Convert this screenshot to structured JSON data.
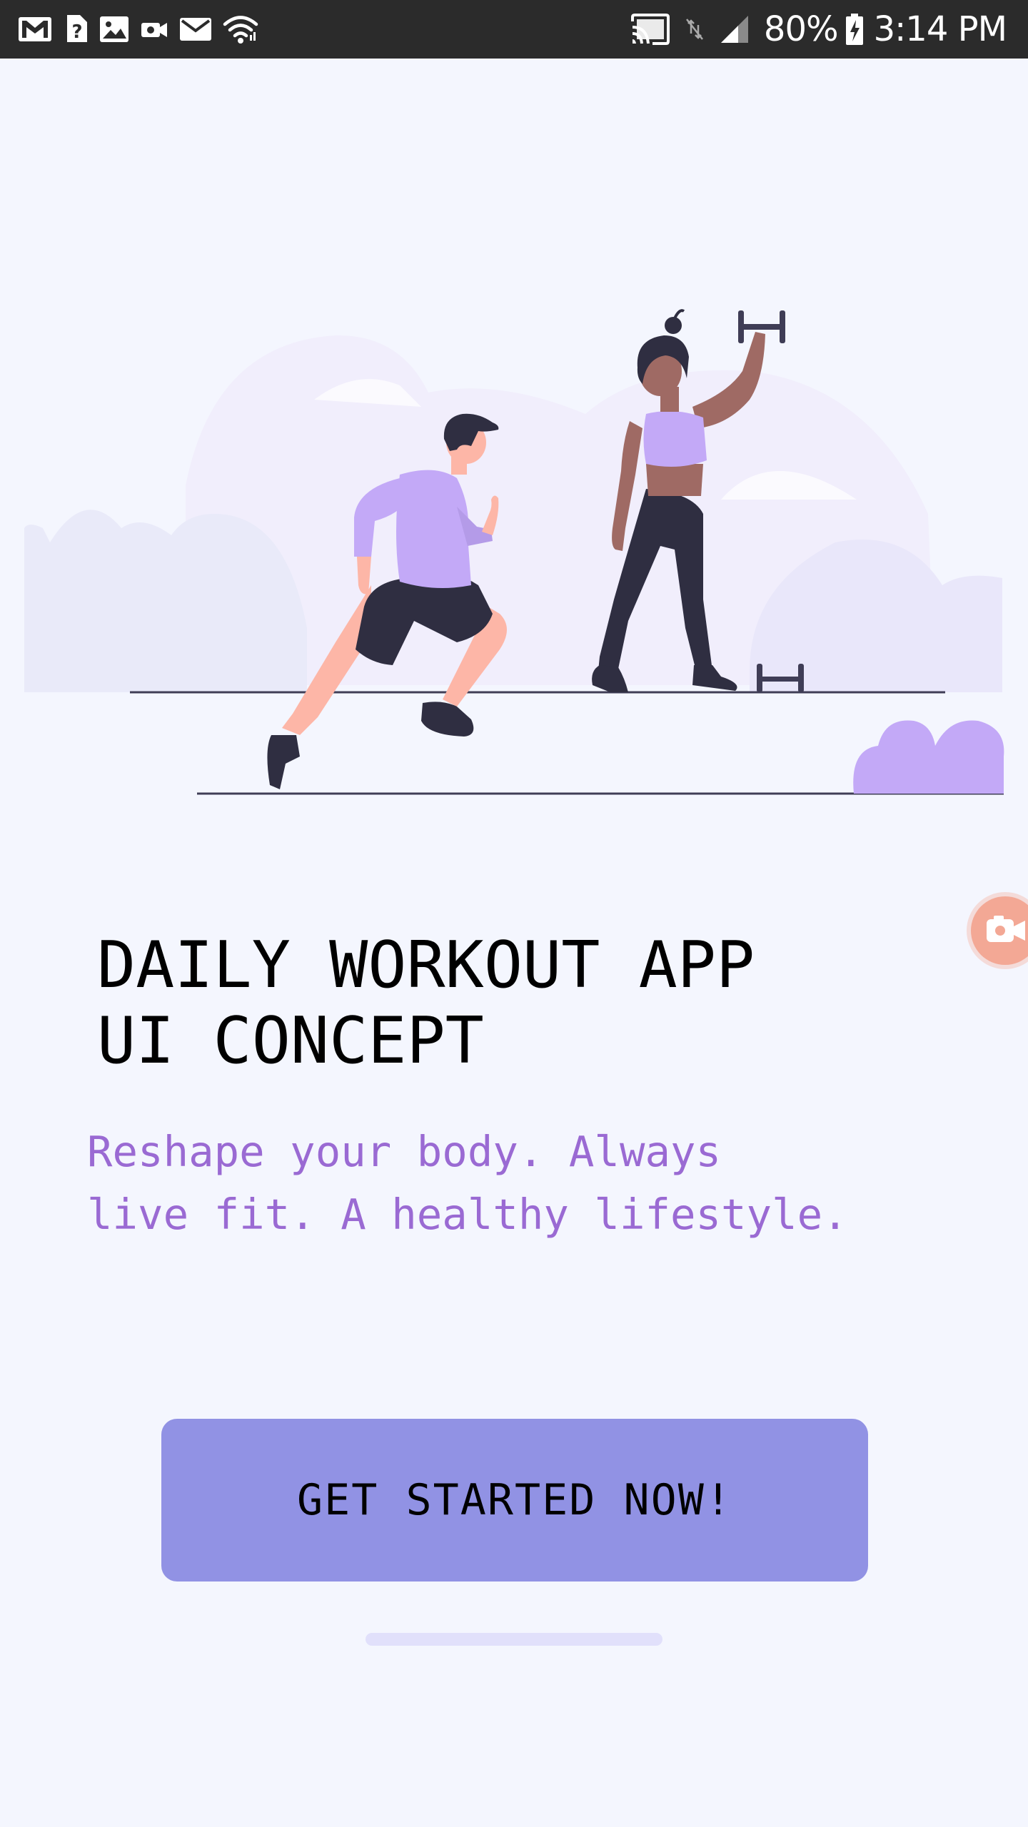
{
  "status_bar": {
    "left_icons": [
      "gmail-icon",
      "help-icon",
      "gallery-icon",
      "video-camera-icon",
      "mail-icon",
      "wifi-icon"
    ],
    "right_icons": [
      "cast-icon",
      "no-data-icon",
      "signal-icon",
      "battery-charging-icon"
    ],
    "battery": "80%",
    "time": "3:14 PM"
  },
  "hero": {
    "illustration": "workout-illustration"
  },
  "content": {
    "title_line1": "DAILY WORKOUT APP",
    "title_line2": "UI CONCEPT",
    "subtitle_line1": "Reshape your body. Always",
    "subtitle_line2": "live fit. A healthy lifestyle."
  },
  "cta": {
    "label": "GET STARTED NOW!"
  },
  "floating": {
    "icon": "screen-recorder-icon"
  },
  "colors": {
    "background": "#f4f6fe",
    "accent_purple": "#c3a9f7",
    "button": "#9192e4",
    "subtitle": "#9a6ad3",
    "dark": "#2f2e41",
    "skin_light": "#fdb6a7",
    "skin_dark": "#9f6a64"
  }
}
